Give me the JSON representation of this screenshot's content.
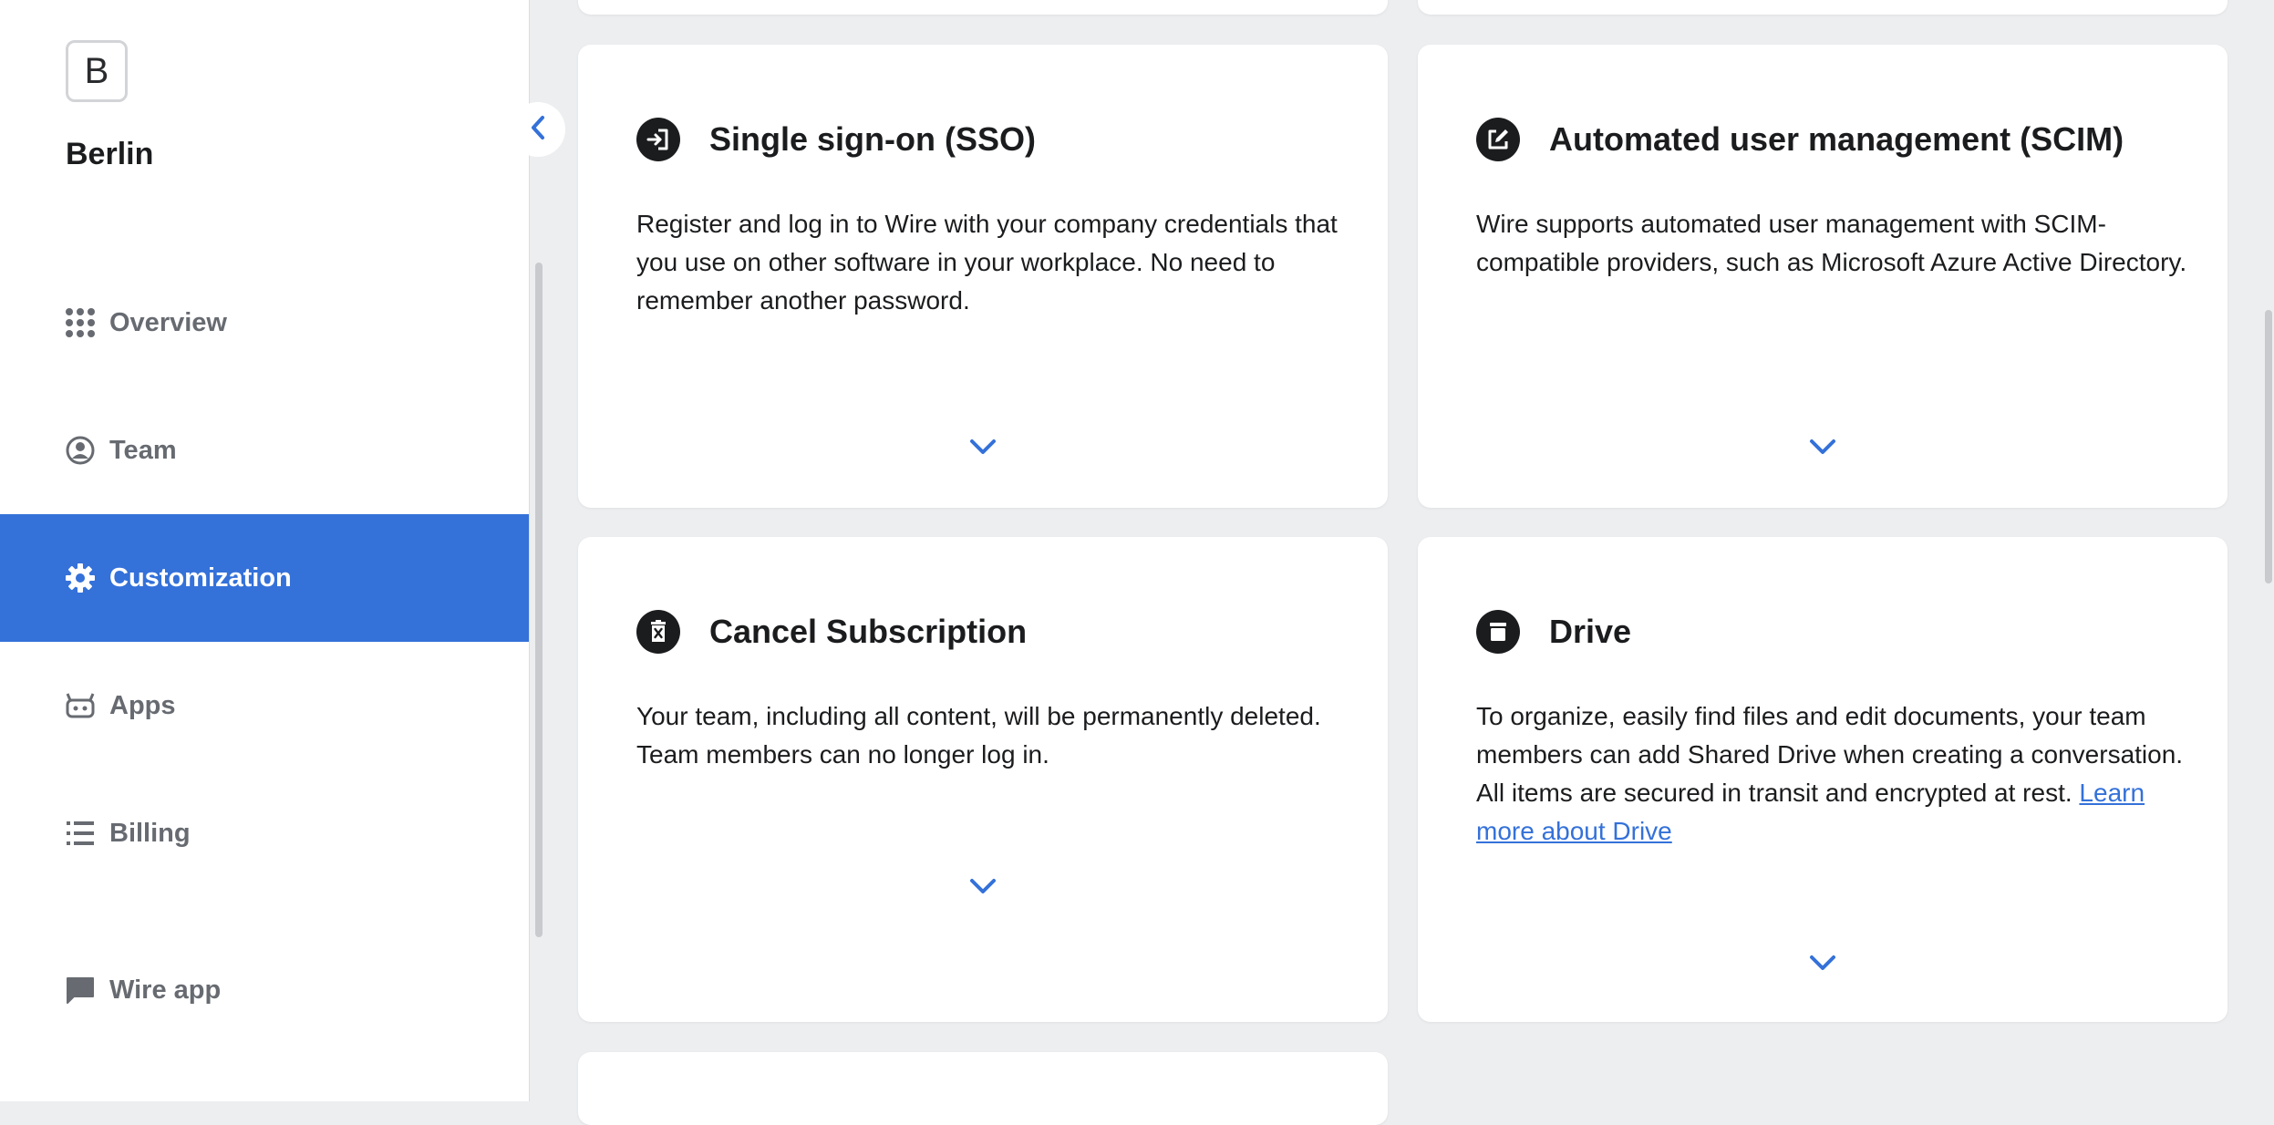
{
  "sidebar": {
    "logo_letter": "B",
    "team_name": "Berlin",
    "items": [
      {
        "label": "Overview",
        "icon": "grid-icon",
        "active": false
      },
      {
        "label": "Team",
        "icon": "user-circle-icon",
        "active": false
      },
      {
        "label": "Customization",
        "icon": "gear-icon",
        "active": true
      },
      {
        "label": "Apps",
        "icon": "robot-icon",
        "active": false
      },
      {
        "label": "Billing",
        "icon": "list-icon",
        "active": false
      },
      {
        "label": "Wire app",
        "icon": "chat-bubble-icon",
        "active": false
      }
    ]
  },
  "cards": {
    "sso": {
      "title": "Single sign-on (SSO)",
      "description": "Register and log in to Wire with your company credentials that you use on other software in your workplace. No need to remember another password.",
      "icon": "sign-in-icon"
    },
    "scim": {
      "title": "Automated user management (SCIM)",
      "description": "Wire supports automated user management with SCIM-compatible providers, such as Microsoft Azure Active Directory.",
      "icon": "edit-square-icon"
    },
    "cancel": {
      "title": "Cancel Subscription",
      "description": "Your team, including all content, will be permanently deleted. Team members can no longer log in.",
      "icon": "trash-icon"
    },
    "drive": {
      "title": "Drive",
      "description": "To organize, easily find files and edit documents, your team members can add Shared Drive when creating a conversation. All items are secured in transit and encrypted at rest.",
      "link_text": "Learn more about Drive",
      "icon": "archive-icon"
    }
  },
  "colors": {
    "accent": "#3471d9",
    "background": "#edeef0",
    "card": "#ffffff",
    "text": "#1b1c1e",
    "muted": "#676b71"
  }
}
